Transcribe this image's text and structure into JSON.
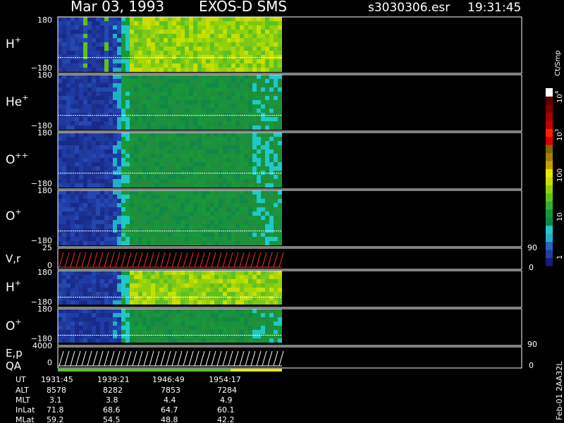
{
  "header": {
    "date": "Mar 03, 1993",
    "instrument": "EXOS-D SMS",
    "file": "s3030306.esr",
    "time": "19:31:45"
  },
  "panels": [
    {
      "label": "H",
      "sup": "+",
      "top_tick": "180",
      "bottom_tick": "−180"
    },
    {
      "label": "He",
      "sup": "+",
      "top_tick": "180",
      "bottom_tick": "−180"
    },
    {
      "label": "O",
      "sup": "++",
      "top_tick": "180",
      "bottom_tick": "−180"
    },
    {
      "label": "O",
      "sup": "+",
      "top_tick": "180",
      "bottom_tick": "−180"
    },
    {
      "label": "V,r",
      "sup": "",
      "top_tick": "25",
      "bottom_tick": "0",
      "right_top": "90",
      "right_bottom": "0"
    },
    {
      "label": "H",
      "sup": "+",
      "top_tick": "180",
      "bottom_tick": "−180"
    },
    {
      "label": "O",
      "sup": "+",
      "top_tick": "180",
      "bottom_tick": "−180"
    },
    {
      "label": "E,p",
      "sup": "",
      "top_tick": "4000",
      "bottom_tick": "0",
      "right_top": "90",
      "right_bottom": "0"
    }
  ],
  "qa_label": "QA",
  "colorbar": {
    "unit": "Ct/Smp",
    "ticks": [
      {
        "base": "10",
        "exp": "4"
      },
      {
        "base": "10",
        "exp": "3"
      },
      {
        "base": "100",
        "exp": ""
      },
      {
        "base": "10",
        "exp": ""
      },
      {
        "base": "1",
        "exp": ""
      }
    ],
    "colors": [
      "#1a1a7a",
      "#2040a0",
      "#2860c0",
      "#20b0c8",
      "#20c8c8",
      "#108848",
      "#189838",
      "#30b030",
      "#60c020",
      "#90d010",
      "#c8e000",
      "#e8e800",
      "#c8a000",
      "#a08000",
      "#806800",
      "#d80000",
      "#ff2000",
      "#c00000",
      "#a00000",
      "#800000",
      "#600000",
      "#ffffff"
    ]
  },
  "footer_id": "Feb-01 2AA32L",
  "ephemeris": {
    "rows": [
      {
        "label": "UT",
        "values": [
          "1931:45",
          "1939:21",
          "1946:49",
          "1954:17"
        ]
      },
      {
        "label": "ALT",
        "values": [
          "8578",
          "8282",
          "7853",
          "7284"
        ]
      },
      {
        "label": "MLT",
        "values": [
          "3.1",
          "3.8",
          "4.4",
          "4.9"
        ]
      },
      {
        "label": "InLat",
        "values": [
          "71.8",
          "68.6",
          "64.7",
          "60.1"
        ]
      },
      {
        "label": "MLat",
        "values": [
          "59.2",
          "54.5",
          "48.8",
          "42.2"
        ]
      }
    ]
  },
  "chart_data": {
    "type": "heatmap",
    "title": "Mar 03, 1993   EXOS-D SMS",
    "x_time_ticks": [
      "1931:45",
      "1939:21",
      "1946:49",
      "1954:17"
    ],
    "color_scale": "log",
    "color_range": [
      1,
      10000
    ],
    "color_unit": "Ct/Smp",
    "panels": [
      {
        "name": "H+",
        "ylim": [
          -180,
          180
        ]
      },
      {
        "name": "He+",
        "ylim": [
          -180,
          180
        ]
      },
      {
        "name": "O++",
        "ylim": [
          -180,
          180
        ]
      },
      {
        "name": "O+",
        "ylim": [
          -180,
          180
        ]
      },
      {
        "name": "V,r",
        "ylim": [
          0,
          25
        ],
        "ylim_right": [
          0,
          90
        ]
      },
      {
        "name": "H+",
        "ylim": [
          -180,
          180
        ]
      },
      {
        "name": "O+",
        "ylim": [
          -180,
          180
        ]
      },
      {
        "name": "E,p",
        "ylim": [
          0,
          4000
        ],
        "ylim_right": [
          0,
          90
        ]
      }
    ]
  }
}
